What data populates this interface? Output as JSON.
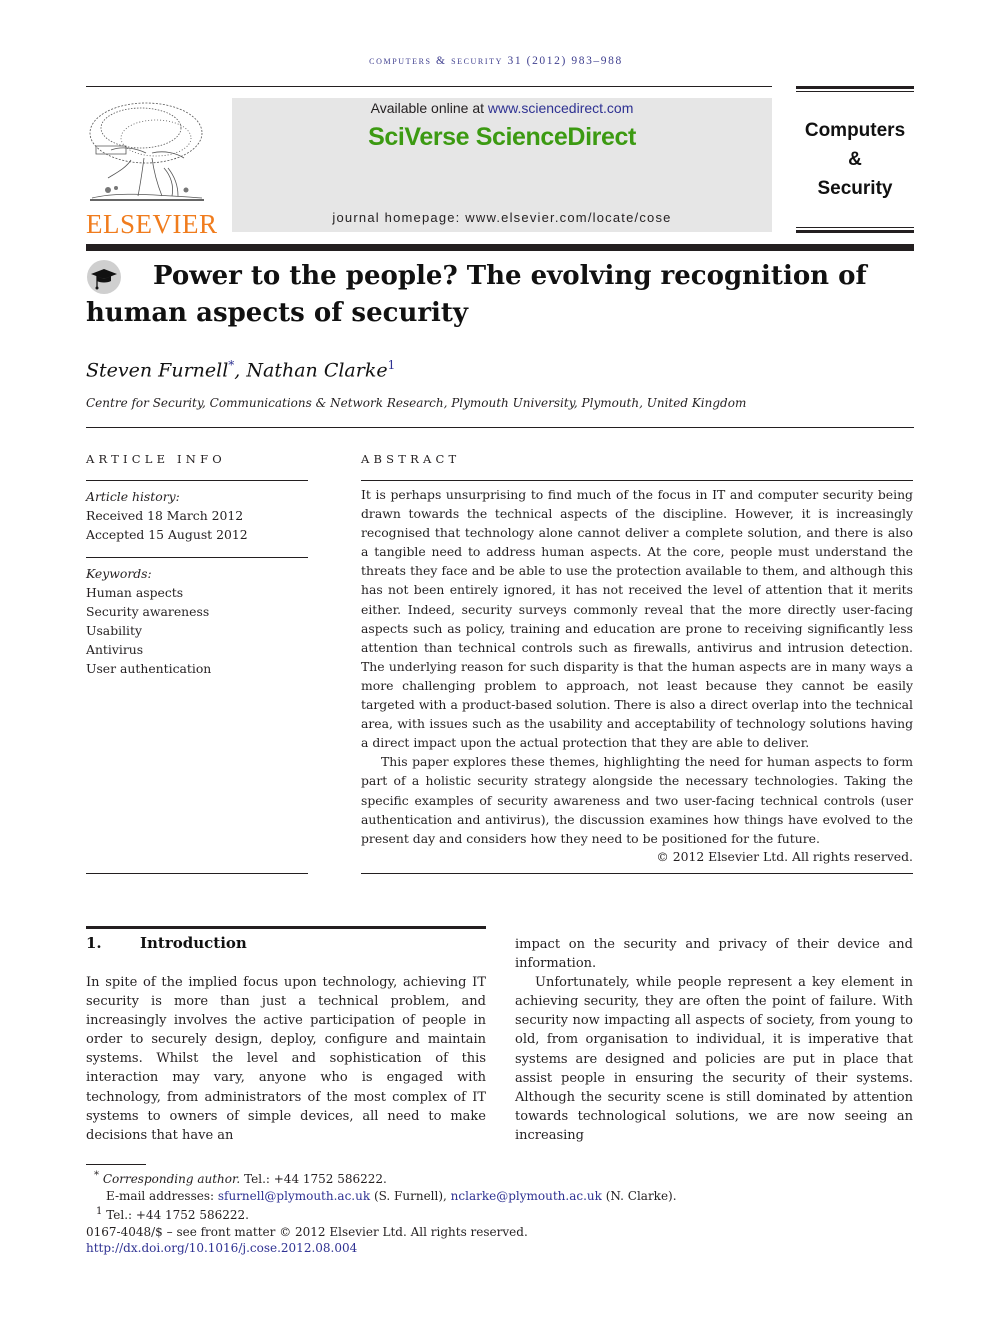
{
  "running_head": "Computers & Security 31 (2012) 983–988",
  "header": {
    "publisher_logo_text": "ELSEVIER",
    "available_online_prefix": "Available online at ",
    "available_online_link": "www.sciencedirect.com",
    "platform_name": "SciVerse ScienceDirect",
    "journal_homepage": "journal homepage: www.elsevier.com/locate/cose",
    "journal_name_lines": [
      "Computers",
      "&",
      "Security"
    ],
    "brand_colors": {
      "sciverse_green": "#3c9a12",
      "elsevier_orange": "#f07c1d",
      "banner_gray": "#e6e6e6",
      "link_blue": "#2e3192"
    }
  },
  "article": {
    "title": "Power to the people? The evolving recognition of human aspects of security",
    "title_icon": "graduation-cap-icon",
    "authors": [
      {
        "name": "Steven Furnell",
        "mark": "*"
      },
      {
        "name": "Nathan Clarke",
        "mark": "1"
      }
    ],
    "author_separator": ", ",
    "affiliation": "Centre for Security, Communications & Network Research, Plymouth University, Plymouth, United Kingdom"
  },
  "article_info": {
    "label": "ARTICLE INFO",
    "history_label": "Article history:",
    "received": "Received 18 March 2012",
    "accepted": "Accepted 15 August 2012",
    "keywords_label": "Keywords:",
    "keywords": [
      "Human aspects",
      "Security awareness",
      "Usability",
      "Antivirus",
      "User authentication"
    ]
  },
  "abstract": {
    "label": "ABSTRACT",
    "paragraphs": [
      "It is perhaps unsurprising to find much of the focus in IT and computer security being drawn towards the technical aspects of the discipline. However, it is increasingly recognised that technology alone cannot deliver a complete solution, and there is also a tangible need to address human aspects. At the core, people must understand the threats they face and be able to use the protection available to them, and although this has not been entirely ignored, it has not received the level of attention that it merits either. Indeed, security surveys commonly reveal that the more directly user-facing aspects such as policy, training and education are prone to receiving significantly less attention than technical controls such as firewalls, antivirus and intrusion detection. The underlying reason for such disparity is that the human aspects are in many ways a more challenging problem to approach, not least because they cannot be easily targeted with a product-based solution. There is also a direct overlap into the technical area, with issues such as the usability and acceptability of technology solutions having a direct impact upon the actual protection that they are able to deliver.",
      "This paper explores these themes, highlighting the need for human aspects to form part of a holistic security strategy alongside the necessary technologies. Taking the specific examples of security awareness and two user-facing technical controls (user authentication and antivirus), the discussion examines how things have evolved to the present day and considers how they need to be positioned for the future."
    ],
    "copyright": "© 2012 Elsevier Ltd. All rights reserved."
  },
  "body": {
    "section_number": "1.",
    "section_title": "Introduction",
    "left_column": "In spite of the implied focus upon technology, achieving IT security is more than just a technical problem, and increasingly involves the active participation of people in order to securely design, deploy, configure and maintain systems. Whilst the level and sophistication of this interaction may vary, anyone who is engaged with technology, from administrators of the most complex of IT systems to owners of simple devices, all need to make decisions that have an",
    "right_column_continuation": "impact on the security and privacy of their device and information.",
    "right_column_paragraph": "Unfortunately, while people represent a key element in achieving security, they are often the point of failure. With security now impacting all aspects of society, from young to old, from organisation to individual, it is imperative that systems are designed and policies are put in place that assist people in ensuring the security of their systems. Although the security scene is still dominated by attention towards technological solutions, we are now seeing an increasing"
  },
  "footnotes": {
    "corresponding_mark": "*",
    "corresponding_label": "Corresponding author.",
    "corresponding_tel": " Tel.: +44 1752 586222.",
    "email_label": "E-mail addresses: ",
    "email_1": "sfurnell@plymouth.ac.uk",
    "email_1_owner": " (S. Furnell), ",
    "email_2": "nclarke@plymouth.ac.uk",
    "email_2_owner": " (N. Clarke).",
    "note_1_mark": "1",
    "note_1_text": " Tel.: +44 1752 586222.",
    "front_matter": "0167-4048/$ – see front matter © 2012 Elsevier Ltd. All rights reserved.",
    "doi": "http://dx.doi.org/10.1016/j.cose.2012.08.004"
  }
}
